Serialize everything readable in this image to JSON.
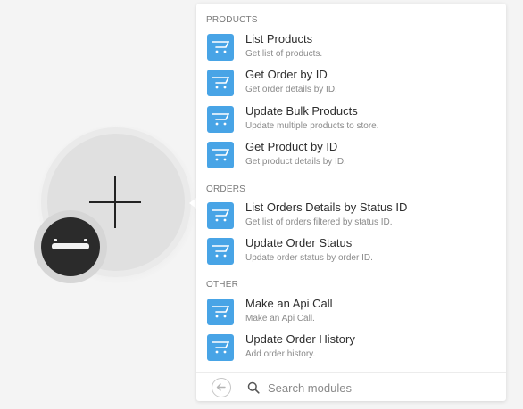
{
  "canvas": {
    "add_node_icon": "plus-icon",
    "app_icon": "opencart-logo-icon"
  },
  "panel": {
    "sections": [
      {
        "label": "PRODUCTS",
        "items": [
          {
            "title": "List Products",
            "desc": "Get list of products.",
            "icon": "cart-icon"
          },
          {
            "title": "Get Order by ID",
            "desc": "Get order details by ID.",
            "icon": "cart-icon"
          },
          {
            "title": "Update Bulk Products",
            "desc": "Update multiple products to store.",
            "icon": "cart-icon"
          },
          {
            "title": "Get Product by ID",
            "desc": "Get product details by ID.",
            "icon": "cart-icon"
          }
        ]
      },
      {
        "label": "ORDERS",
        "items": [
          {
            "title": "List Orders Details by Status ID",
            "desc": "Get list of orders filtered by status ID.",
            "icon": "cart-icon"
          },
          {
            "title": "Update Order Status",
            "desc": "Update order status by order ID.",
            "icon": "cart-icon"
          }
        ]
      },
      {
        "label": "OTHER",
        "items": [
          {
            "title": "Make an Api Call",
            "desc": "Make an Api Call.",
            "icon": "cart-icon"
          },
          {
            "title": "Update Order History",
            "desc": "Add order history.",
            "icon": "cart-icon"
          }
        ]
      }
    ],
    "footer": {
      "back_icon": "arrow-left-icon",
      "search_icon": "search-icon",
      "search_placeholder": "Search modules",
      "search_value": ""
    }
  },
  "colors": {
    "accent": "#48a4e6",
    "panel_bg": "#ffffff",
    "canvas_bg": "#f4f4f4"
  }
}
